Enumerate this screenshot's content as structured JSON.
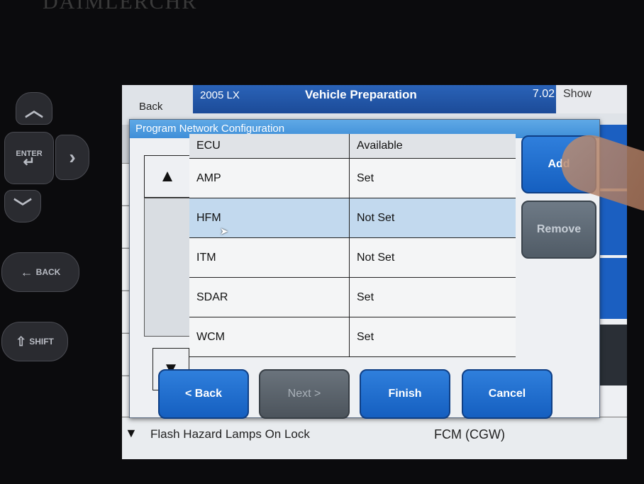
{
  "device": {
    "brand_partial": "DAIMLERCHR",
    "hw_buttons": {
      "up_icon": "chevron-up-icon",
      "enter_label": "ENTER",
      "right_icon": "chevron-right-icon",
      "down_icon": "chevron-down-icon",
      "back_label": "BACK",
      "shift_label": "SHIFT"
    }
  },
  "background_screen": {
    "back_label": "Back",
    "model": "2005  LX",
    "title": "Vehicle Preparation",
    "version": "7.02",
    "show_label": "Show",
    "bottom_row_text": "Flash Hazard Lamps On Lock",
    "bottom_row_right": "FCM (CGW)"
  },
  "dialog": {
    "title": "Program Network Configuration",
    "columns": {
      "ecu": "ECU",
      "status": "Available"
    },
    "rows": [
      {
        "ecu": "AMP",
        "status": "Set"
      },
      {
        "ecu": "HFM",
        "status": "Not Set"
      },
      {
        "ecu": "ITM",
        "status": "Not Set"
      },
      {
        "ecu": "SDAR",
        "status": "Set"
      },
      {
        "ecu": "WCM",
        "status": "Set"
      }
    ],
    "selected_row": 1,
    "add_label": "Add",
    "remove_label": "Remove",
    "buttons": {
      "back": "< Back",
      "next": "Next >",
      "finish": "Finish",
      "cancel": "Cancel"
    }
  },
  "colors": {
    "accent_blue": "#1c5fc0",
    "title_blue": "#3f8ed8",
    "selected_row": "#c2d9ee"
  }
}
